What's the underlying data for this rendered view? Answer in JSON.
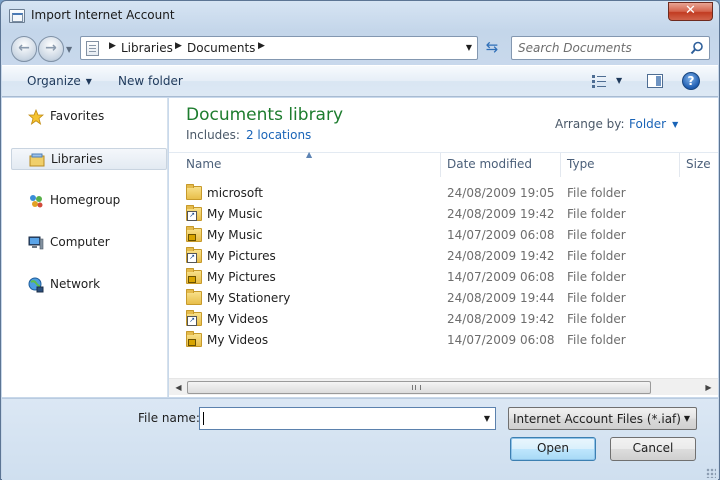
{
  "window": {
    "title": "Import Internet Account",
    "close_label": "✕"
  },
  "address_bar": {
    "breadcrumbs": [
      "Libraries",
      "Documents"
    ]
  },
  "search": {
    "placeholder": "Search Documents"
  },
  "toolbar": {
    "organize_label": "Organize",
    "new_folder_label": "New folder",
    "help_label": "?"
  },
  "nav_pane": {
    "items": [
      {
        "label": "Favorites",
        "icon": "star-icon",
        "selected": false
      },
      {
        "label": "Libraries",
        "icon": "library-icon",
        "selected": true
      },
      {
        "label": "Homegroup",
        "icon": "homegroup-icon",
        "selected": false
      },
      {
        "label": "Computer",
        "icon": "computer-icon",
        "selected": false
      },
      {
        "label": "Network",
        "icon": "network-icon",
        "selected": false
      }
    ]
  },
  "library": {
    "title": "Documents library",
    "includes_label": "Includes:",
    "includes_link": "2 locations",
    "arrange_label": "Arrange by:",
    "arrange_value": "Folder"
  },
  "columns": {
    "name": "Name",
    "date": "Date modified",
    "type": "Type",
    "size": "Size"
  },
  "files": [
    {
      "name": "microsoft",
      "date": "24/08/2009 19:05",
      "type": "File folder",
      "icon": "folder-icon"
    },
    {
      "name": "My Music",
      "date": "24/08/2009 19:42",
      "type": "File folder",
      "icon": "folder-shortcut-icon"
    },
    {
      "name": "My Music",
      "date": "14/07/2009 06:08",
      "type": "File folder",
      "icon": "folder-locked-icon"
    },
    {
      "name": "My Pictures",
      "date": "24/08/2009 19:42",
      "type": "File folder",
      "icon": "folder-shortcut-icon"
    },
    {
      "name": "My Pictures",
      "date": "14/07/2009 06:08",
      "type": "File folder",
      "icon": "folder-locked-icon"
    },
    {
      "name": "My Stationery",
      "date": "24/08/2009 19:44",
      "type": "File folder",
      "icon": "folder-icon"
    },
    {
      "name": "My Videos",
      "date": "24/08/2009 19:42",
      "type": "File folder",
      "icon": "folder-shortcut-icon"
    },
    {
      "name": "My Videos",
      "date": "14/07/2009 06:08",
      "type": "File folder",
      "icon": "folder-locked-icon"
    }
  ],
  "bottom": {
    "file_name_label": "File name:",
    "file_name_value": "",
    "filter_value": "Internet Account Files (*.iaf)",
    "open_label": "Open",
    "cancel_label": "Cancel"
  },
  "colors": {
    "library_title": "#1d7c2e",
    "link": "#1a64b7",
    "close_button": "#c13b21"
  }
}
